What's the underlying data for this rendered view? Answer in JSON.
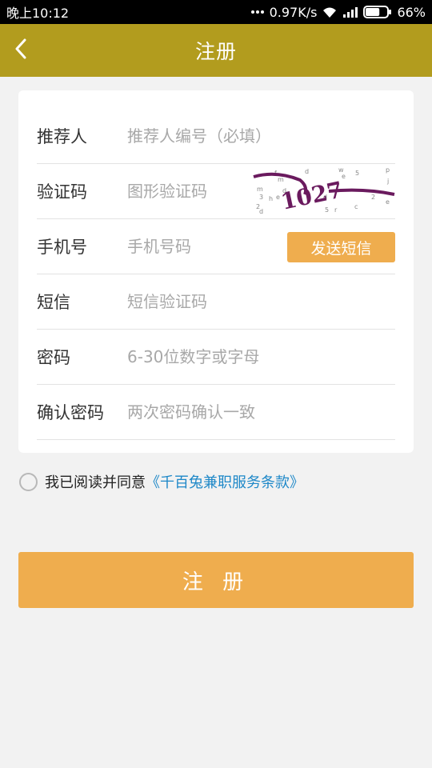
{
  "status_bar": {
    "time": "晚上10:12",
    "network_speed": "0.97K/s",
    "battery": "66%",
    "battery_level": 0.66
  },
  "header": {
    "title": "注册",
    "back_icon": "chevron-left-icon"
  },
  "form": {
    "rows": [
      {
        "label": "推荐人",
        "placeholder": "推荐人编号（必填）"
      },
      {
        "label": "验证码",
        "placeholder": "图形验证码"
      },
      {
        "label": "手机号",
        "placeholder": "手机号码"
      },
      {
        "label": "短信",
        "placeholder": "短信验证码"
      },
      {
        "label": "密码",
        "placeholder": "6-30位数字或字母"
      },
      {
        "label": "确认密码",
        "placeholder": "两次密码确认一致"
      }
    ],
    "captcha_text": "1027",
    "send_sms_label": "发送短信"
  },
  "agreement": {
    "text": "我已阅读并同意",
    "link": "《千百兔兼职服务条款》"
  },
  "submit_label": "注 册",
  "colors": {
    "header": "#b29c1e",
    "accent": "#efad4e",
    "link": "#1e88c8",
    "captcha": "#6a1a5e"
  }
}
